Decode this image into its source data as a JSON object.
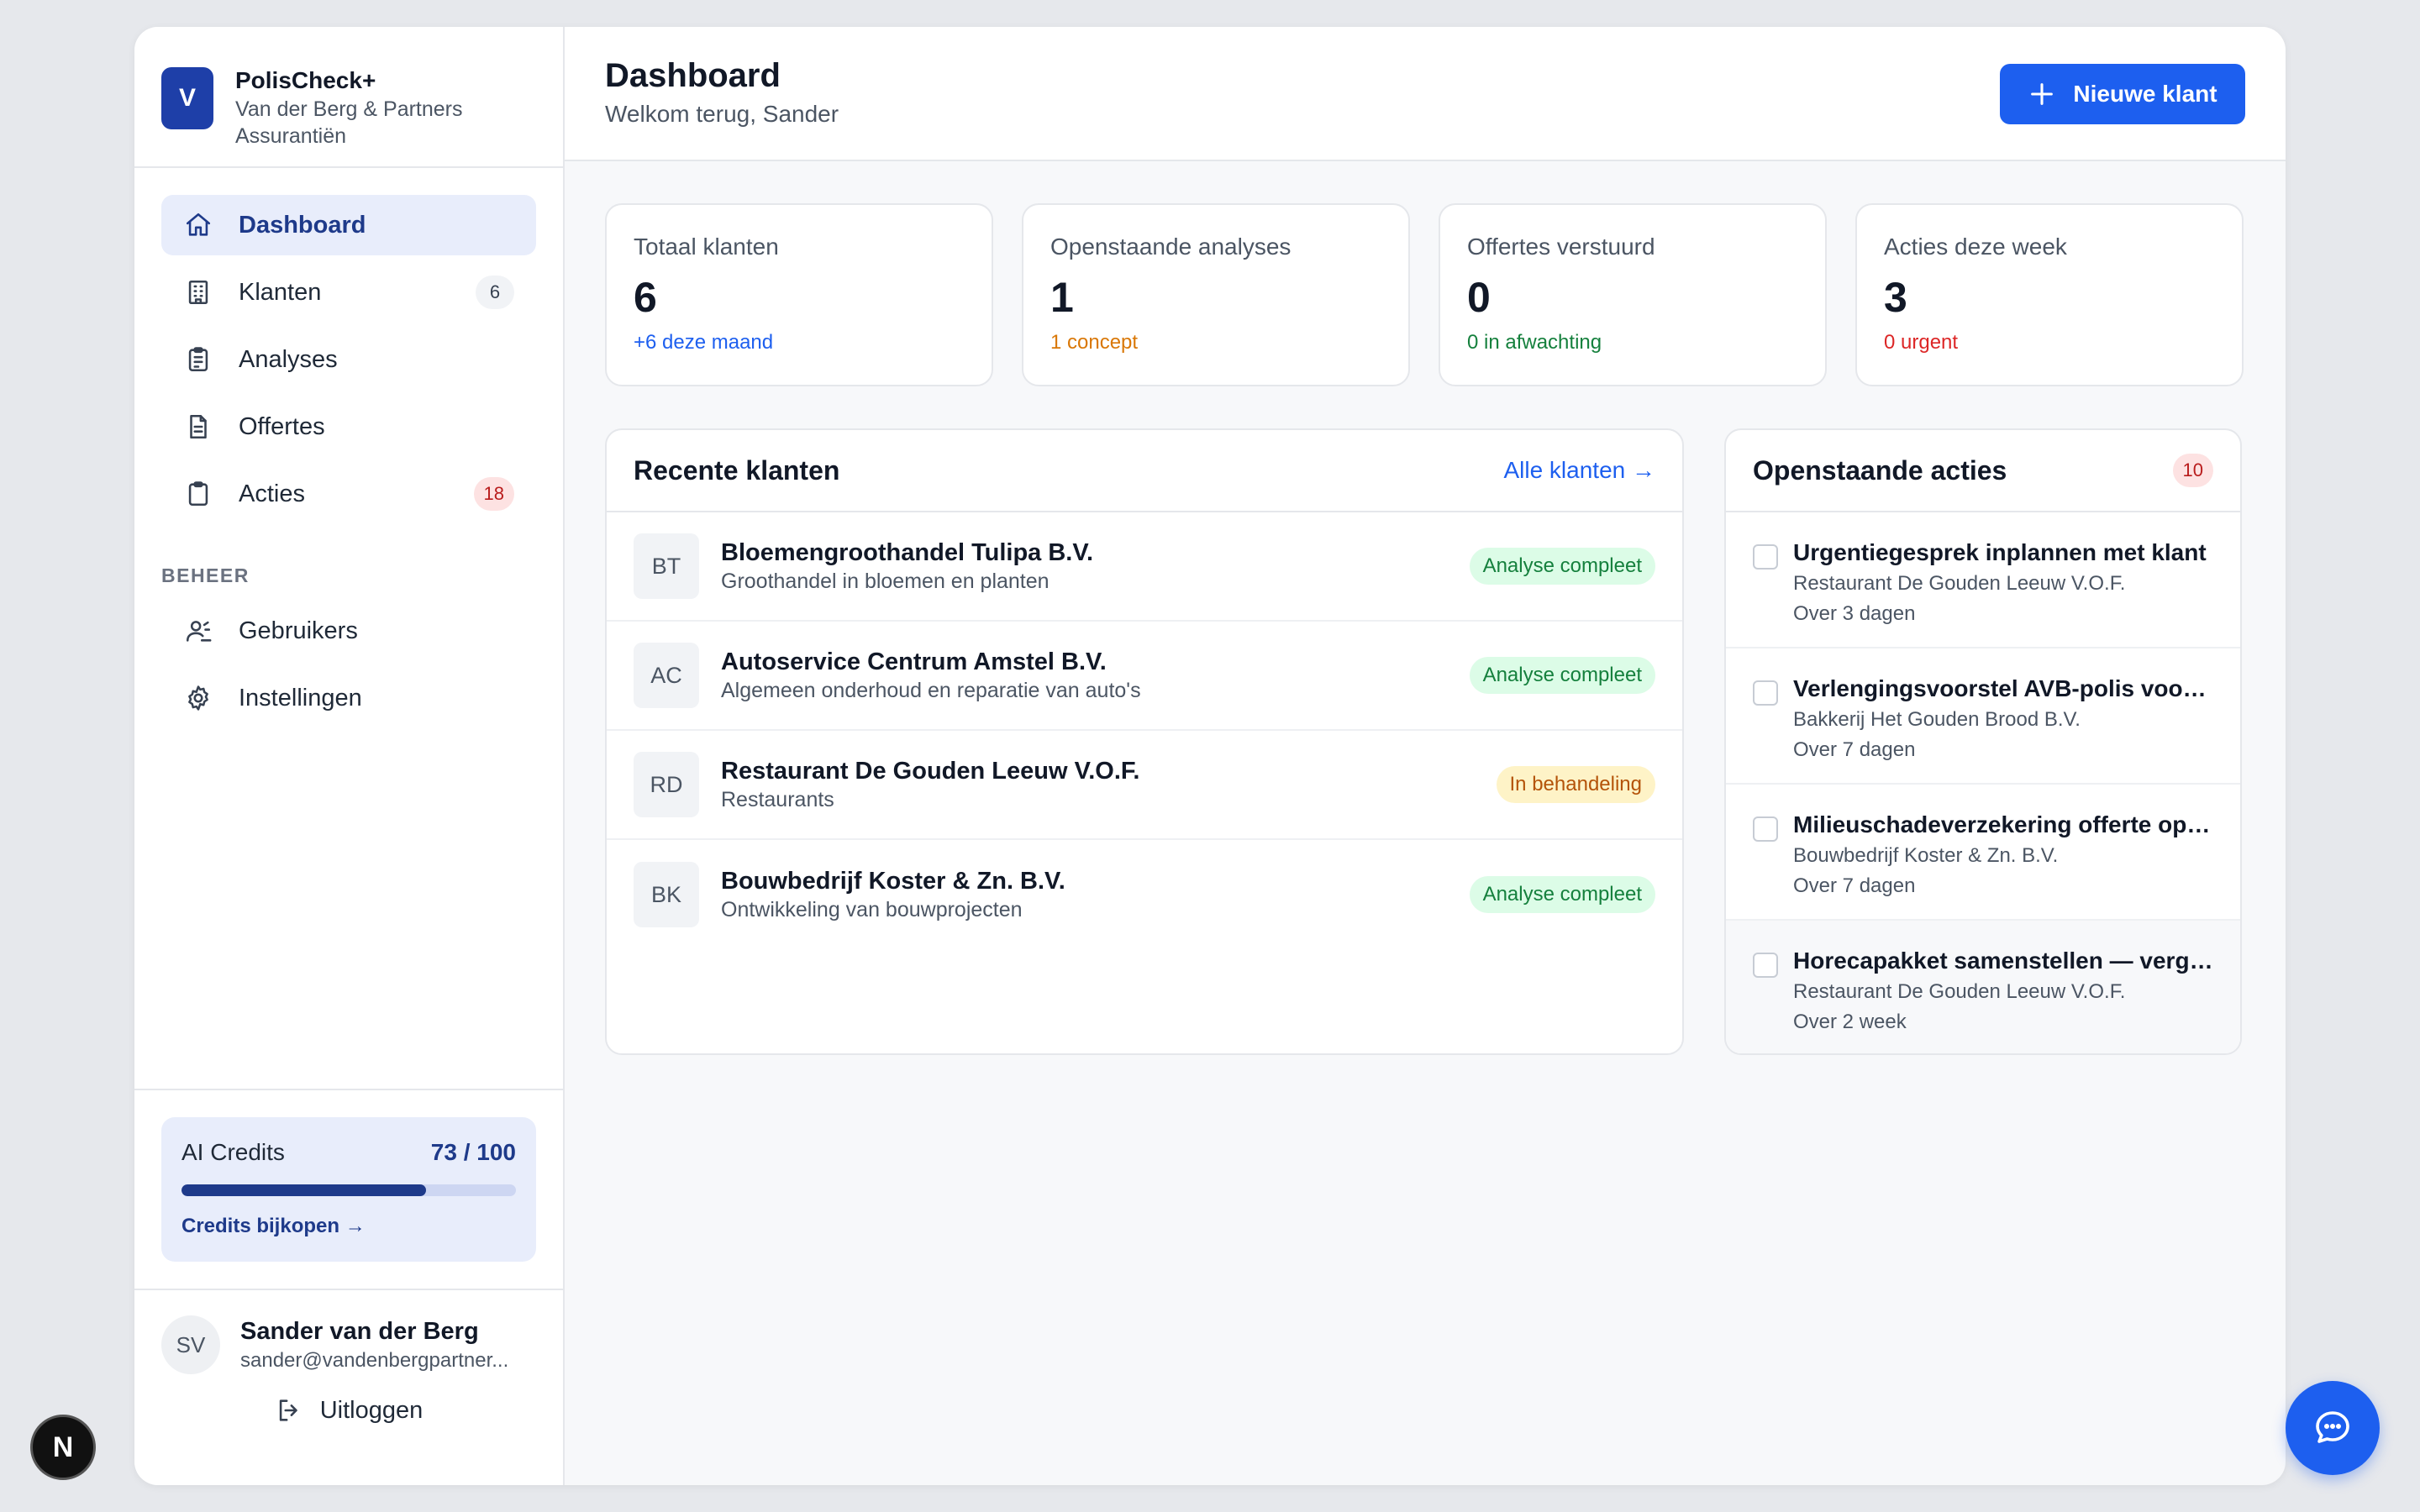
{
  "brand": {
    "logo_letter": "V",
    "name": "PolisCheck+",
    "org": "Van der Berg & Partners Assurantiën"
  },
  "nav": {
    "items": [
      {
        "label": "Dashboard",
        "icon": "home-icon",
        "active": true
      },
      {
        "label": "Klanten",
        "icon": "building-icon",
        "count": "6"
      },
      {
        "label": "Analyses",
        "icon": "clipboard-list-icon"
      },
      {
        "label": "Offertes",
        "icon": "document-icon"
      },
      {
        "label": "Acties",
        "icon": "clipboard-icon",
        "count": "18"
      }
    ],
    "section_label": "BEHEER",
    "admin_items": [
      {
        "label": "Gebruikers",
        "icon": "users-icon"
      },
      {
        "label": "Instellingen",
        "icon": "gear-icon"
      }
    ]
  },
  "credits": {
    "title": "AI Credits",
    "value": "73 / 100",
    "used": 73,
    "total": 100,
    "link": "Credits bijkopen →"
  },
  "user": {
    "initials": "SV",
    "name": "Sander van der Berg",
    "email": "sander@vandenbergpartner...",
    "logout": "Uitloggen"
  },
  "header": {
    "title": "Dashboard",
    "subtitle": "Welkom terug, Sander",
    "new_client": "Nieuwe klant"
  },
  "stats": [
    {
      "label": "Totaal klanten",
      "value": "6",
      "note": "+6 deze maand",
      "note_color": "#1d5fef"
    },
    {
      "label": "Openstaande analyses",
      "value": "1",
      "note": "1 concept",
      "note_color": "#d97706"
    },
    {
      "label": "Offertes verstuurd",
      "value": "0",
      "note": "0 in afwachting",
      "note_color": "#15803d"
    },
    {
      "label": "Acties deze week",
      "value": "3",
      "note": "0 urgent",
      "note_color": "#dc2626"
    }
  ],
  "recent_clients": {
    "title": "Recente klanten",
    "link": "Alle klanten →",
    "rows": [
      {
        "initials": "BT",
        "name": "Bloemengroothandel Tulipa B.V.",
        "desc": "Groothandel in bloemen en planten",
        "status": "Analyse compleet"
      },
      {
        "initials": "AC",
        "name": "Autoservice Centrum Amstel B.V.",
        "desc": "Algemeen onderhoud en reparatie van auto's",
        "status": "Analyse compleet"
      },
      {
        "initials": "RD",
        "name": "Restaurant De Gouden Leeuw V.O.F.",
        "desc": "Restaurants",
        "status": "In behandeling"
      },
      {
        "initials": "BK",
        "name": "Bouwbedrijf Koster & Zn. B.V.",
        "desc": "Ontwikkeling van bouwprojecten",
        "status": "Analyse compleet"
      }
    ]
  },
  "open_actions": {
    "title": "Openstaande acties",
    "count": "10",
    "rows": [
      {
        "title": "Urgentiegesprek inplannen met klant",
        "client": "Restaurant De Gouden Leeuw V.O.F.",
        "due": "Over 3 dagen"
      },
      {
        "title": "Verlengingsvoorstel AVB-polis voorbereiden",
        "client": "Bakkerij Het Gouden Brood B.V.",
        "due": "Over 7 dagen"
      },
      {
        "title": "Milieuschadeverzekering offerte opvragen",
        "client": "Bouwbedrijf Koster & Zn. B.V.",
        "due": "Over 7 dagen"
      },
      {
        "title": "Horecapakket samenstellen — vergelijken",
        "client": "Restaurant De Gouden Leeuw V.O.F.",
        "due": "Over 2 week"
      }
    ]
  },
  "colors": {
    "accent": "#1d5fef",
    "brand": "#1e3fa8",
    "active_bg": "#e8edfb"
  },
  "fab_icon": "chat-icon",
  "dev_indicator": "N"
}
